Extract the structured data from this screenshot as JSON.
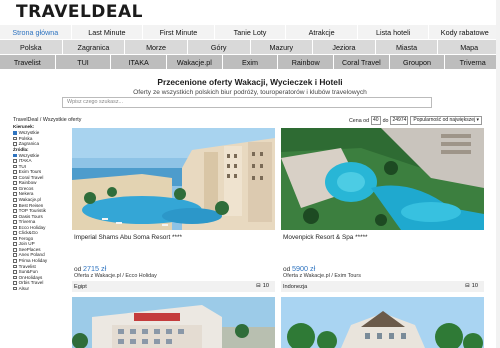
{
  "logo": "TRAVELDEAL",
  "nav": {
    "row1": [
      {
        "label": "Strona główna",
        "active": true
      },
      {
        "label": "Last Minute"
      },
      {
        "label": "First Minute"
      },
      {
        "label": "Tanie Loty"
      },
      {
        "label": "Atrakcje"
      },
      {
        "label": "Lista hoteli"
      },
      {
        "label": "Kody rabatowe"
      }
    ],
    "row2": [
      {
        "label": "Polska"
      },
      {
        "label": "Zagranica"
      },
      {
        "label": "Morze"
      },
      {
        "label": "Góry"
      },
      {
        "label": "Mazury"
      },
      {
        "label": "Jeziora"
      },
      {
        "label": "Miasta"
      },
      {
        "label": "Mapa"
      }
    ],
    "row3": [
      {
        "label": "Travelist"
      },
      {
        "label": "TUI"
      },
      {
        "label": "ITAKA"
      },
      {
        "label": "Wakacje.pl"
      },
      {
        "label": "Exim"
      },
      {
        "label": "Rainbow"
      },
      {
        "label": "Coral Travel"
      },
      {
        "label": "Groupon"
      },
      {
        "label": "Triverna"
      }
    ]
  },
  "page": {
    "title": "Przecenione oferty Wakacji, Wycieczek i Hoteli",
    "subtitle": "Oferty ze wszystkich polskich biur podróży, touroperatorów i klubów travelowych"
  },
  "search": {
    "placeholder": "Wpisz czego szukasz..."
  },
  "breadcrumb": "TravelDeal / Wszystkie oferty",
  "sort": {
    "price_label": "Cena od",
    "min": "40",
    "to_label": "do",
    "max": "24974",
    "order": "Popularność od największej"
  },
  "filters": {
    "destination_heading": "Kierunek:",
    "destinations": [
      {
        "label": "Wszystkie",
        "checked": true
      },
      {
        "label": "Polska"
      },
      {
        "label": "Zagranica"
      }
    ],
    "source_heading": "Źródła:",
    "sources": [
      {
        "label": "Wszystkie",
        "checked": true
      },
      {
        "label": "ITAKA"
      },
      {
        "label": "TUI"
      },
      {
        "label": "Exim Tours"
      },
      {
        "label": "Coral Travel"
      },
      {
        "label": "Rainbow"
      },
      {
        "label": "Grecos"
      },
      {
        "label": "Nekera"
      },
      {
        "label": "Wakacje.pl"
      },
      {
        "label": "Best Reisen"
      },
      {
        "label": "TOP Touristik"
      },
      {
        "label": "Oasis Tours"
      },
      {
        "label": "Triverna"
      },
      {
        "label": "Ecco Holiday"
      },
      {
        "label": "Click&Go"
      },
      {
        "label": "Ferogo"
      },
      {
        "label": "Join UP"
      },
      {
        "label": "SeePlaces"
      },
      {
        "label": "Anex Poland"
      },
      {
        "label": "Prima Holiday"
      },
      {
        "label": "Travelist"
      },
      {
        "label": "Sun&Fun"
      },
      {
        "label": "OnHolidays"
      },
      {
        "label": "Orbis Travel"
      },
      {
        "label": "Alsur"
      }
    ]
  },
  "offers": [
    {
      "name": "Imperial Shams Abu Soma Resort ****",
      "price_label": "od",
      "price": "2715 zł",
      "offer": "Oferta z Wakacje.pl / Ecco Holiday",
      "country": "Egipt",
      "count": "10"
    },
    {
      "name": "Movenpick Resort & Spa *****",
      "price_label": "od",
      "price": "5900 zł",
      "offer": "Oferta z Wakacje.pl / Exim Tours",
      "country": "Indonezja",
      "count": "10"
    },
    {
      "name": "",
      "price": "",
      "offer": "",
      "country": "",
      "count": ""
    },
    {
      "name": "",
      "price": "",
      "offer": "",
      "country": "",
      "count": ""
    }
  ],
  "colors": {
    "accent": "#2f74c0",
    "nav1": "#f3f3f3",
    "nav2": "#d9d9d9",
    "nav3": "#bdbdbd"
  }
}
